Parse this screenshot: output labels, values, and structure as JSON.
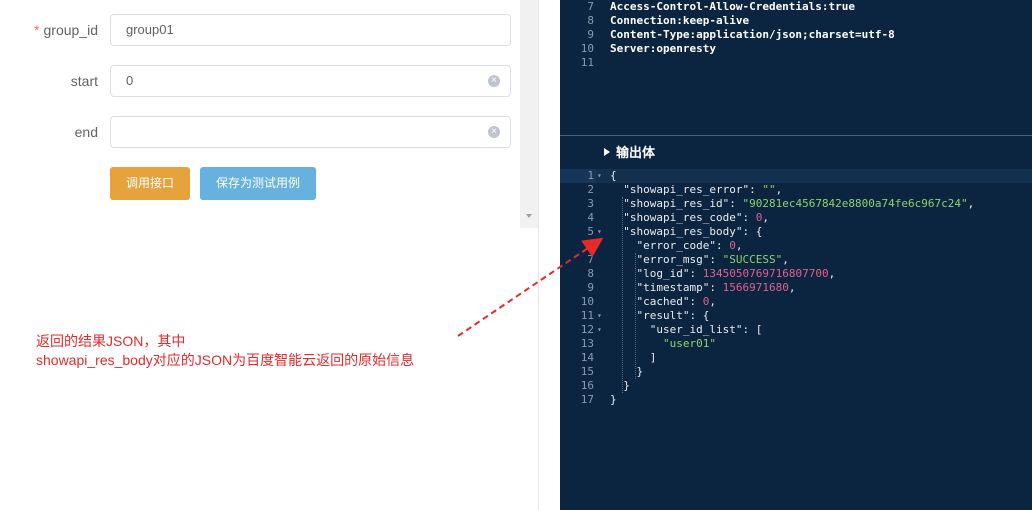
{
  "form": {
    "group_id": {
      "label": "group_id",
      "required_mark": "*",
      "value": "group01"
    },
    "start": {
      "label": "start",
      "value": "0"
    },
    "end": {
      "label": "end",
      "value": ""
    },
    "call_button": "调用接口",
    "save_button": "保存为测试用例"
  },
  "headers_panel": {
    "lines": [
      {
        "num": "7",
        "text": "Access-Control-Allow-Credentials:true"
      },
      {
        "num": "8",
        "text": "Connection:keep-alive"
      },
      {
        "num": "9",
        "text": "Content-Type:application/json;charset=utf-8"
      },
      {
        "num": "10",
        "text": "Server:openresty"
      },
      {
        "num": "11",
        "text": ""
      }
    ]
  },
  "output": {
    "title": "输出体",
    "lines": [
      {
        "num": "1",
        "fold": true,
        "tokens": [
          [
            "p",
            "{"
          ]
        ]
      },
      {
        "num": "2",
        "tokens": [
          [
            "p",
            "  "
          ],
          [
            "k",
            "\"showapi_res_error\""
          ],
          [
            "p",
            ": "
          ],
          [
            "s",
            "\"\""
          ],
          [
            "p",
            ","
          ]
        ]
      },
      {
        "num": "3",
        "tokens": [
          [
            "p",
            "  "
          ],
          [
            "k",
            "\"showapi_res_id\""
          ],
          [
            "p",
            ": "
          ],
          [
            "s",
            "\"90281ec4567842e8800a74fe6c967c24\""
          ],
          [
            "p",
            ","
          ]
        ]
      },
      {
        "num": "4",
        "tokens": [
          [
            "p",
            "  "
          ],
          [
            "k",
            "\"showapi_res_code\""
          ],
          [
            "p",
            ": "
          ],
          [
            "n",
            "0"
          ],
          [
            "p",
            ","
          ]
        ]
      },
      {
        "num": "5",
        "fold": true,
        "tokens": [
          [
            "p",
            "  "
          ],
          [
            "k",
            "\"showapi_res_body\""
          ],
          [
            "p",
            ": {"
          ]
        ]
      },
      {
        "num": "6",
        "tokens": [
          [
            "p",
            "    "
          ],
          [
            "k",
            "\"error_code\""
          ],
          [
            "p",
            ": "
          ],
          [
            "n",
            "0"
          ],
          [
            "p",
            ","
          ]
        ]
      },
      {
        "num": "7",
        "tokens": [
          [
            "p",
            "    "
          ],
          [
            "k",
            "\"error_msg\""
          ],
          [
            "p",
            ": "
          ],
          [
            "s",
            "\"SUCCESS\""
          ],
          [
            "p",
            ","
          ]
        ]
      },
      {
        "num": "8",
        "tokens": [
          [
            "p",
            "    "
          ],
          [
            "k",
            "\"log_id\""
          ],
          [
            "p",
            ": "
          ],
          [
            "n",
            "1345050769716807700"
          ],
          [
            "p",
            ","
          ]
        ]
      },
      {
        "num": "9",
        "tokens": [
          [
            "p",
            "    "
          ],
          [
            "k",
            "\"timestamp\""
          ],
          [
            "p",
            ": "
          ],
          [
            "n",
            "1566971680"
          ],
          [
            "p",
            ","
          ]
        ]
      },
      {
        "num": "10",
        "tokens": [
          [
            "p",
            "    "
          ],
          [
            "k",
            "\"cached\""
          ],
          [
            "p",
            ": "
          ],
          [
            "n",
            "0"
          ],
          [
            "p",
            ","
          ]
        ]
      },
      {
        "num": "11",
        "fold": true,
        "tokens": [
          [
            "p",
            "    "
          ],
          [
            "k",
            "\"result\""
          ],
          [
            "p",
            ": {"
          ]
        ]
      },
      {
        "num": "12",
        "fold": true,
        "tokens": [
          [
            "p",
            "      "
          ],
          [
            "k",
            "\"user_id_list\""
          ],
          [
            "p",
            ": ["
          ]
        ]
      },
      {
        "num": "13",
        "tokens": [
          [
            "p",
            "        "
          ],
          [
            "s",
            "\"user01\""
          ]
        ]
      },
      {
        "num": "14",
        "tokens": [
          [
            "p",
            "      ]"
          ]
        ]
      },
      {
        "num": "15",
        "tokens": [
          [
            "p",
            "    }"
          ]
        ]
      },
      {
        "num": "16",
        "tokens": [
          [
            "p",
            "  }"
          ]
        ]
      },
      {
        "num": "17",
        "tokens": [
          [
            "p",
            "}"
          ]
        ]
      }
    ]
  },
  "annotation": {
    "line1": "返回的结果JSON，其中",
    "line2": "showapi_res_body对应的JSON为百度智能云返回的原始信息",
    "color": "#e52a2a"
  },
  "colors": {
    "panel_bg": "#0b2540",
    "call_button": "#e6a23c",
    "save_button": "#66b1de",
    "required": "#f56c6c"
  }
}
